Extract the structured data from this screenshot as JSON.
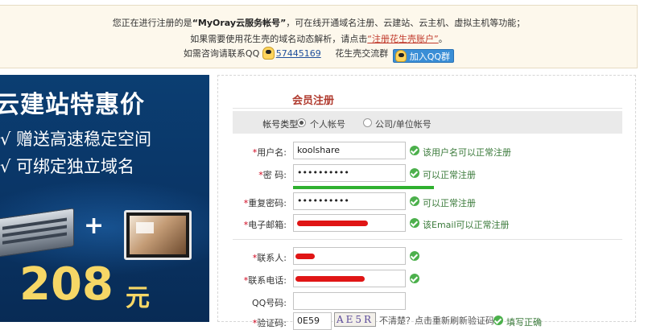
{
  "notice": {
    "line1_prefix": "您正在进行注册的是",
    "line1_brand": "“MyOray云服务帐号”",
    "line1_suffix": "，可在线开通域名注册、云建站、云主机、虚拟主机等功能；",
    "line2_prefix": "如果需要使用花生壳的域名动态解析，请点击",
    "line2_link": "“注册花生壳账户”",
    "line2_suffix": "。",
    "line3_prefix": "如需咨询请联系QQ",
    "qq_number": "57445169",
    "group_label": "花生壳交流群",
    "qq_group_button": "加入QQ群"
  },
  "promo": {
    "title": "云建站特惠价",
    "line1": "√  赠送高速稳定空间",
    "line2": "√  可绑定独立域名",
    "plus": "+",
    "price": "208",
    "unit": "元"
  },
  "form": {
    "title": "会员注册",
    "account_type": {
      "label": "帐号类型:",
      "options": [
        "个人帐号",
        "公司/单位帐号"
      ],
      "selected": "个人帐号"
    },
    "username": {
      "label": "用户名:",
      "value": "koolshare",
      "hint": "该用户名可以正常注册"
    },
    "password": {
      "label": "密 码:",
      "value": "••••••••••",
      "hint": "可以正常注册"
    },
    "password_confirm": {
      "label": "重复密码:",
      "value": "••••••••••",
      "hint": "可以正常注册"
    },
    "email": {
      "label": "电子邮箱:",
      "value": "",
      "hint": "该Email可以正常注册"
    },
    "contact": {
      "label": "联系人:",
      "value": ""
    },
    "phone": {
      "label": "联系电话:",
      "value": ""
    },
    "qq": {
      "label": "QQ号码:",
      "value": ""
    },
    "captcha": {
      "label": "验证码:",
      "value": "0E59",
      "image_text": "AE5R",
      "refresh_text": "不清楚？点击重新刷新验证码",
      "hint": "填写正确"
    }
  },
  "colors": {
    "notice_bg": "#fdf8ec",
    "promo_bg": "#0a3566",
    "price": "#f6d766",
    "title_red": "#b03a2e",
    "ok_green": "#4cb04c",
    "redaction": "#e01515"
  }
}
